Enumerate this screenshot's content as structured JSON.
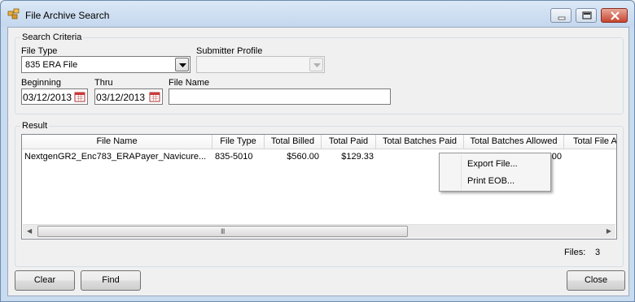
{
  "window": {
    "title": "File Archive Search"
  },
  "criteria": {
    "group_title": "Search Criteria",
    "file_type_label": "File Type",
    "file_type_value": "835 ERA File",
    "submitter_label": "Submitter Profile",
    "submitter_value": "",
    "beginning_label": "Beginning",
    "beginning_value": "03/12/2013",
    "thru_label": "Thru",
    "thru_value": "03/12/2013",
    "file_name_label": "File Name",
    "file_name_value": ""
  },
  "result": {
    "group_title": "Result",
    "columns": [
      "File Name",
      "File Type",
      "Total Billed",
      "Total Paid",
      "Total Batches Paid",
      "Total Batches Allowed",
      "Total File Al"
    ],
    "rows": [
      [
        "NextgenGR2_Enc783_ERAPayer_Navicure...",
        "835-5010",
        "$560.00",
        "$129.33",
        "$0.00",
        "$0.00",
        ""
      ]
    ],
    "files_label": "Files:",
    "files_count": "3"
  },
  "context_menu": {
    "items": [
      "Export File...",
      "Print EOB..."
    ]
  },
  "buttons": {
    "clear": "Clear",
    "find": "Find",
    "close": "Close"
  },
  "scrollbar": {
    "grip": "III"
  }
}
